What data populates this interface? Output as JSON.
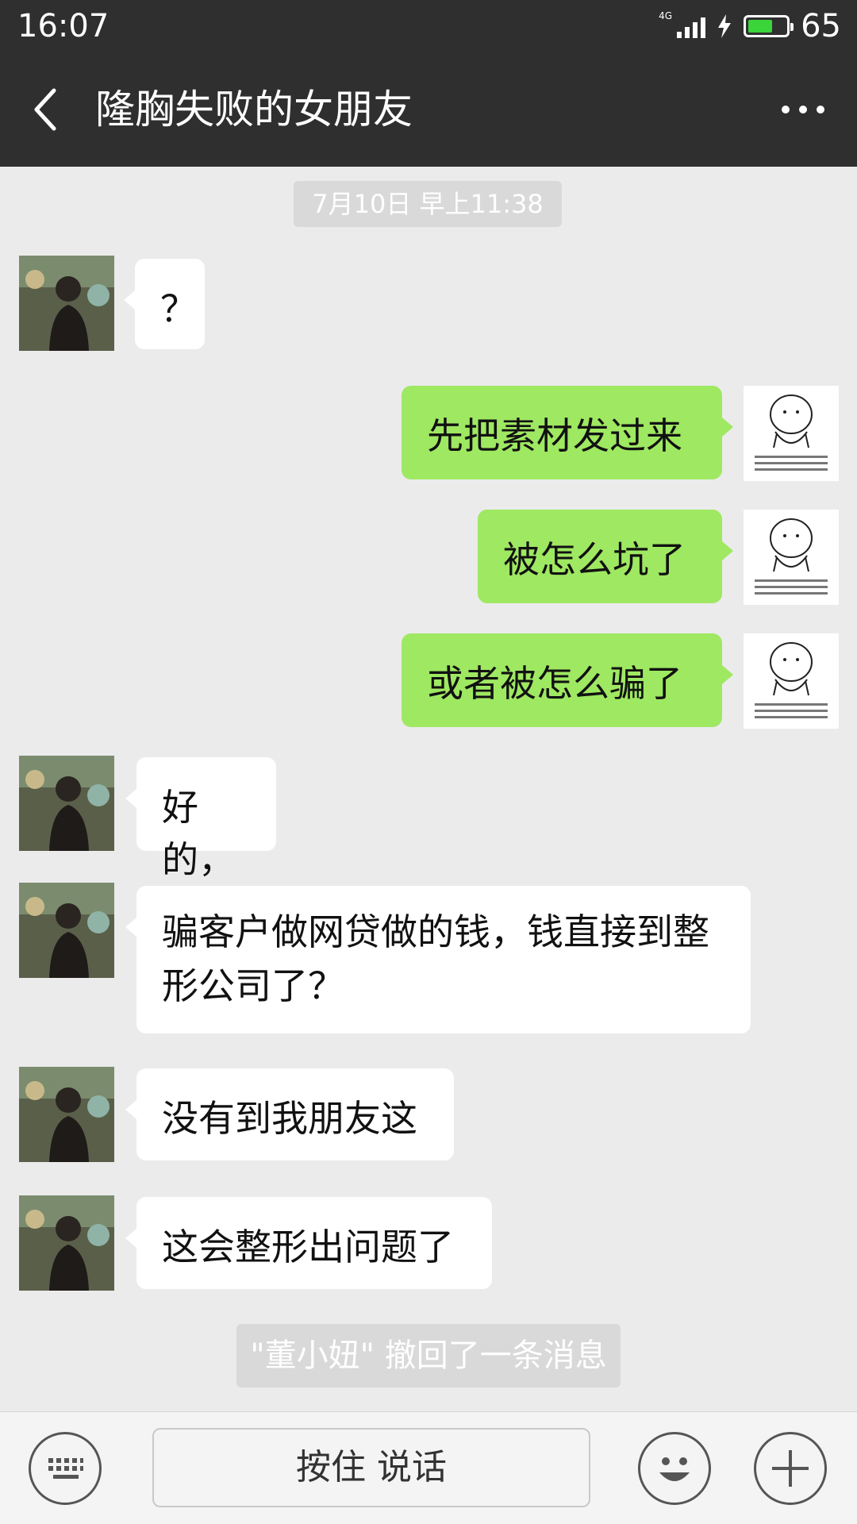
{
  "status_bar": {
    "time": "16:07",
    "network": "4G",
    "battery_percent": "65",
    "battery_level": 0.65,
    "battery_color": "#3bd43b"
  },
  "header": {
    "back_icon": "chevron-left-icon",
    "title": "隆胸失败的女朋友",
    "more_icon": "more-dots-icon"
  },
  "chat": {
    "timestamp": "7月10日 早上11:38",
    "messages": [
      {
        "side": "in",
        "text": "？"
      },
      {
        "side": "out",
        "text": "先把素材发过来"
      },
      {
        "side": "out",
        "text": "被怎么坑了"
      },
      {
        "side": "out",
        "text": "或者被怎么骗了"
      },
      {
        "side": "in",
        "text": "好的，"
      },
      {
        "side": "in",
        "text": "骗客户做网贷做的钱，钱直接到整形公司了？"
      },
      {
        "side": "in",
        "text": "没有到我朋友这"
      },
      {
        "side": "in",
        "text": "这会整形出问题了"
      }
    ],
    "recall_notice": "\"董小妞\" 撤回了一条消息"
  },
  "input_bar": {
    "keyboard_icon": "keyboard-icon",
    "hold_to_talk": "按住 说话",
    "emoji_icon": "emoji-icon",
    "plus_icon": "plus-icon"
  },
  "colors": {
    "header_bg": "#2f2f2f",
    "chat_bg": "#ebebeb",
    "outgoing_bubble": "#9fe862",
    "incoming_bubble": "#ffffff"
  }
}
